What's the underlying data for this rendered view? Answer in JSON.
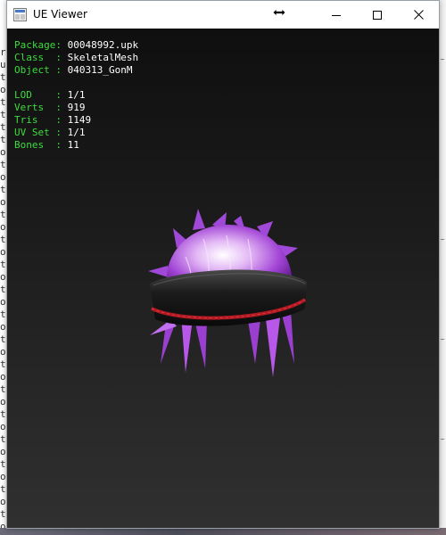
{
  "window": {
    "title": "UE Viewer",
    "app_icon": "ue-viewer-app-icon",
    "controls": [
      "minimize-icon",
      "maximize-icon",
      "close-icon"
    ]
  },
  "background": {
    "console_chars": [
      "r",
      "u",
      "t",
      "o",
      "t",
      "t",
      "t",
      "t",
      "o",
      "t",
      "o",
      "t",
      "o",
      "t",
      "o",
      "t",
      "o",
      "t",
      "o",
      "t",
      "o",
      "t",
      "o",
      "t",
      "o",
      "t",
      "o",
      "t",
      "o",
      "t",
      "o",
      "t",
      "o",
      "t",
      "o",
      "t",
      "o",
      "t",
      "o"
    ]
  },
  "viewer": {
    "info": {
      "package": {
        "label": "Package:",
        "value": "00048992.upk"
      },
      "class": {
        "label": "Class  :",
        "value": "SkeletalMesh"
      },
      "object": {
        "label": "Object :",
        "value": "040313_GonM"
      },
      "lod": {
        "label": "LOD    :",
        "value": "1/1"
      },
      "verts": {
        "label": "Verts  :",
        "value": "919"
      },
      "tris": {
        "label": "Tris   :",
        "value": "1149"
      },
      "uvset": {
        "label": "UV Set :",
        "value": "1/1"
      },
      "bones": {
        "label": "Bones  :",
        "value": "11"
      }
    },
    "mesh_name": "hair-with-headband-mesh"
  },
  "colors": {
    "info_label": "#3ddc3d",
    "info_value": "#ffffff",
    "hair": "#b04ee0",
    "headband": "#1e1e1e",
    "band_stripe": "#b01a22"
  }
}
